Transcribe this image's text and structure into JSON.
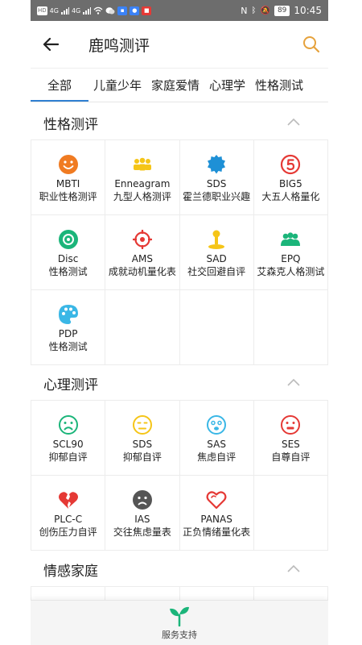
{
  "status_bar": {
    "left_chips": [
      "HD",
      "4G",
      "4G"
    ],
    "battery": "89",
    "time": "10:45"
  },
  "header": {
    "title": "鹿鸣测评",
    "back_icon": "arrow-left-icon",
    "search_icon": "search-icon"
  },
  "tabs": [
    {
      "label": "全部",
      "active": true
    },
    {
      "label": "儿童少年",
      "active": false
    },
    {
      "label": "家庭爱情",
      "active": false
    },
    {
      "label": "心理学",
      "active": false
    },
    {
      "label": "性格测试",
      "active": false
    }
  ],
  "sections": [
    {
      "title": "性格测评",
      "items": [
        {
          "code": "MBTI",
          "desc": "职业性格测评",
          "icon": "smiley-icon",
          "color": "#f07b22"
        },
        {
          "code": "Enneagram",
          "desc": "九型人格测评",
          "icon": "group-icon",
          "color": "#f5c518"
        },
        {
          "code": "SDS",
          "desc": "霍兰德职业兴趣",
          "icon": "badge-icon",
          "color": "#1e90d6"
        },
        {
          "code": "BIG5",
          "desc": "大五人格量化",
          "icon": "number-five-icon",
          "color": "#e53935"
        },
        {
          "code": "Disc",
          "desc": "性格测试",
          "icon": "disc-icon",
          "color": "#1bb57a"
        },
        {
          "code": "AMS",
          "desc": "成就动机量化表",
          "icon": "target-icon",
          "color": "#e53935"
        },
        {
          "code": "SAD",
          "desc": "社交回避自评",
          "icon": "person-pin-icon",
          "color": "#f5c518"
        },
        {
          "code": "EPQ",
          "desc": "艾森克人格测试",
          "icon": "people-icon",
          "color": "#1bb57a"
        },
        {
          "code": "PDP",
          "desc": "性格测试",
          "icon": "palette-icon",
          "color": "#3ab7e6"
        }
      ]
    },
    {
      "title": "心理测评",
      "items": [
        {
          "code": "SCL90",
          "desc": "抑郁自评",
          "icon": "sad-face-icon",
          "color": "#1bb57a"
        },
        {
          "code": "SDS",
          "desc": "抑郁自评",
          "icon": "neutral-face-icon",
          "color": "#f5c518"
        },
        {
          "code": "SAS",
          "desc": "焦虑自评",
          "icon": "anxious-face-icon",
          "color": "#3ab7e6"
        },
        {
          "code": "SES",
          "desc": "自尊自评",
          "icon": "flat-face-icon",
          "color": "#e53935"
        },
        {
          "code": "PLC-C",
          "desc": "创伤压力自评",
          "icon": "broken-heart-icon",
          "color": "#e53935"
        },
        {
          "code": "IAS",
          "desc": "交往焦虑量表",
          "icon": "frown-face-icon",
          "color": "#555555"
        },
        {
          "code": "PANAS",
          "desc": "正负情绪量化表",
          "icon": "heart-outline-icon",
          "color": "#e53935"
        }
      ]
    },
    {
      "title": "情感家庭",
      "items": []
    }
  ],
  "bottom_bar": {
    "label": "服务支持",
    "icon": "sprout-icon",
    "color": "#1bb57a"
  },
  "accent_color": "#2f7fd1"
}
